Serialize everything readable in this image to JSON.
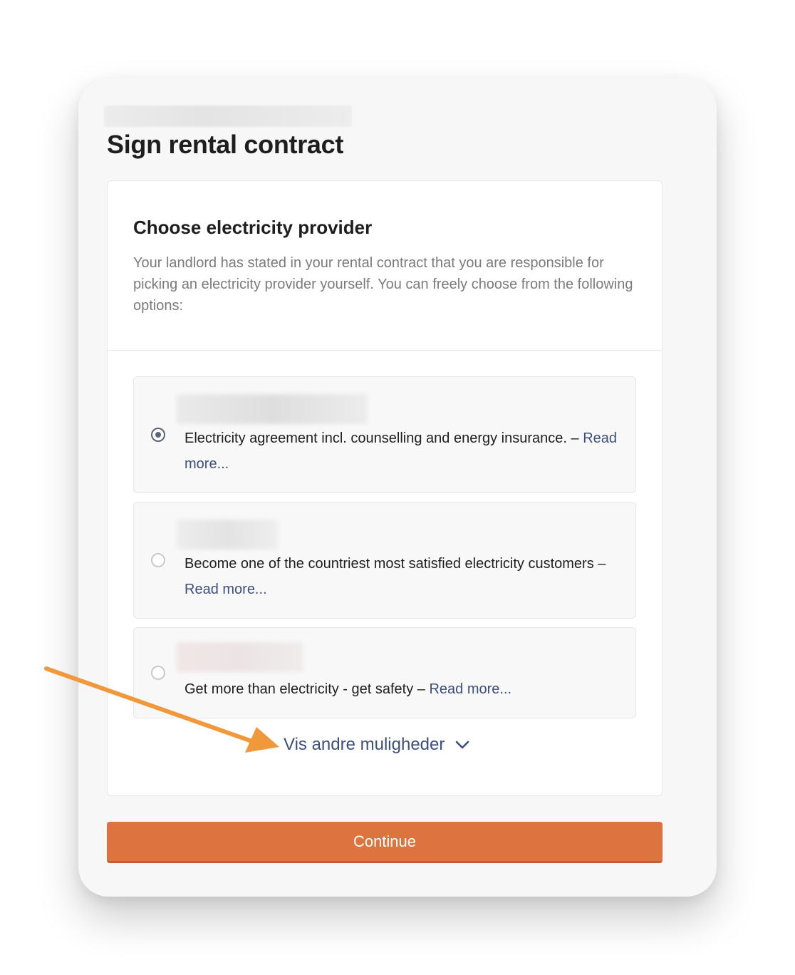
{
  "page": {
    "title": "Sign rental contract"
  },
  "card": {
    "title": "Choose electricity provider",
    "description": "Your landlord has stated in your rental contract that you are responsible for picking an electricity provider yourself. You can freely choose from the following options:"
  },
  "options": [
    {
      "text": "Electricity agreement incl. counselling and energy insurance. –",
      "read_more": "Read more...",
      "selected": true
    },
    {
      "text": "Become one of the countriest most satisfied electricity customers –",
      "read_more": "Read more...",
      "selected": false
    },
    {
      "text": "Get more than electricity - get safety –",
      "read_more": "Read more...",
      "selected": false
    }
  ],
  "show_more": {
    "label": "Vis andre muligheder",
    "icon": "chevron-down-icon"
  },
  "continue_button": {
    "label": "Continue"
  },
  "colors": {
    "accent": "#dd743f",
    "link": "#3c4f7c",
    "annotation_arrow": "#f0983a"
  }
}
